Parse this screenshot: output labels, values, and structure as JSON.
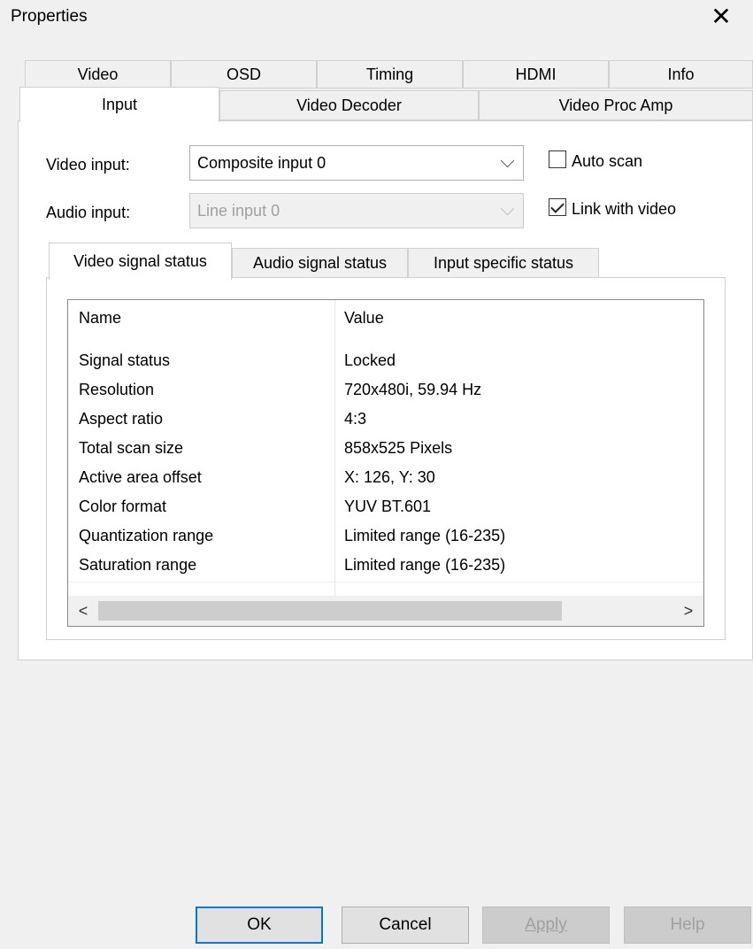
{
  "window": {
    "title": "Properties",
    "close_glyph": "✕"
  },
  "tabs_row1": [
    "Video",
    "OSD",
    "Timing",
    "HDMI",
    "Info"
  ],
  "tabs_row2": [
    "Input",
    "Video Decoder",
    "Video Proc Amp"
  ],
  "form": {
    "video_input_label": "Video input:",
    "video_input_value": "Composite input 0",
    "audio_input_label": "Audio input:",
    "audio_input_value": "Line input 0",
    "auto_scan_label": "Auto scan",
    "auto_scan_checked": false,
    "link_with_video_label": "Link with video",
    "link_with_video_checked": true
  },
  "inner_tabs": [
    "Video signal status",
    "Audio signal status",
    "Input specific status"
  ],
  "list": {
    "columns": [
      "Name",
      "Value"
    ],
    "rows": [
      {
        "name": "Signal status",
        "value": "Locked"
      },
      {
        "name": "Resolution",
        "value": "720x480i, 59.94 Hz"
      },
      {
        "name": "Aspect ratio",
        "value": "4:3"
      },
      {
        "name": "Total scan size",
        "value": "858x525 Pixels"
      },
      {
        "name": "Active area offset",
        "value": "X: 126, Y: 30"
      },
      {
        "name": "Color format",
        "value": "YUV BT.601"
      },
      {
        "name": "Quantization range",
        "value": "Limited range (16-235)"
      },
      {
        "name": "Saturation range",
        "value": "Limited range (16-235)"
      }
    ]
  },
  "scrollbar": {
    "left_arrow": "<",
    "right_arrow": ">"
  },
  "buttons": {
    "ok": "OK",
    "cancel": "Cancel",
    "apply": "Apply",
    "help": "Help"
  },
  "colors": {
    "default_button_border": "#0078d7",
    "panel_bg": "#ffffff",
    "dialog_bg": "#f0f0f0"
  }
}
